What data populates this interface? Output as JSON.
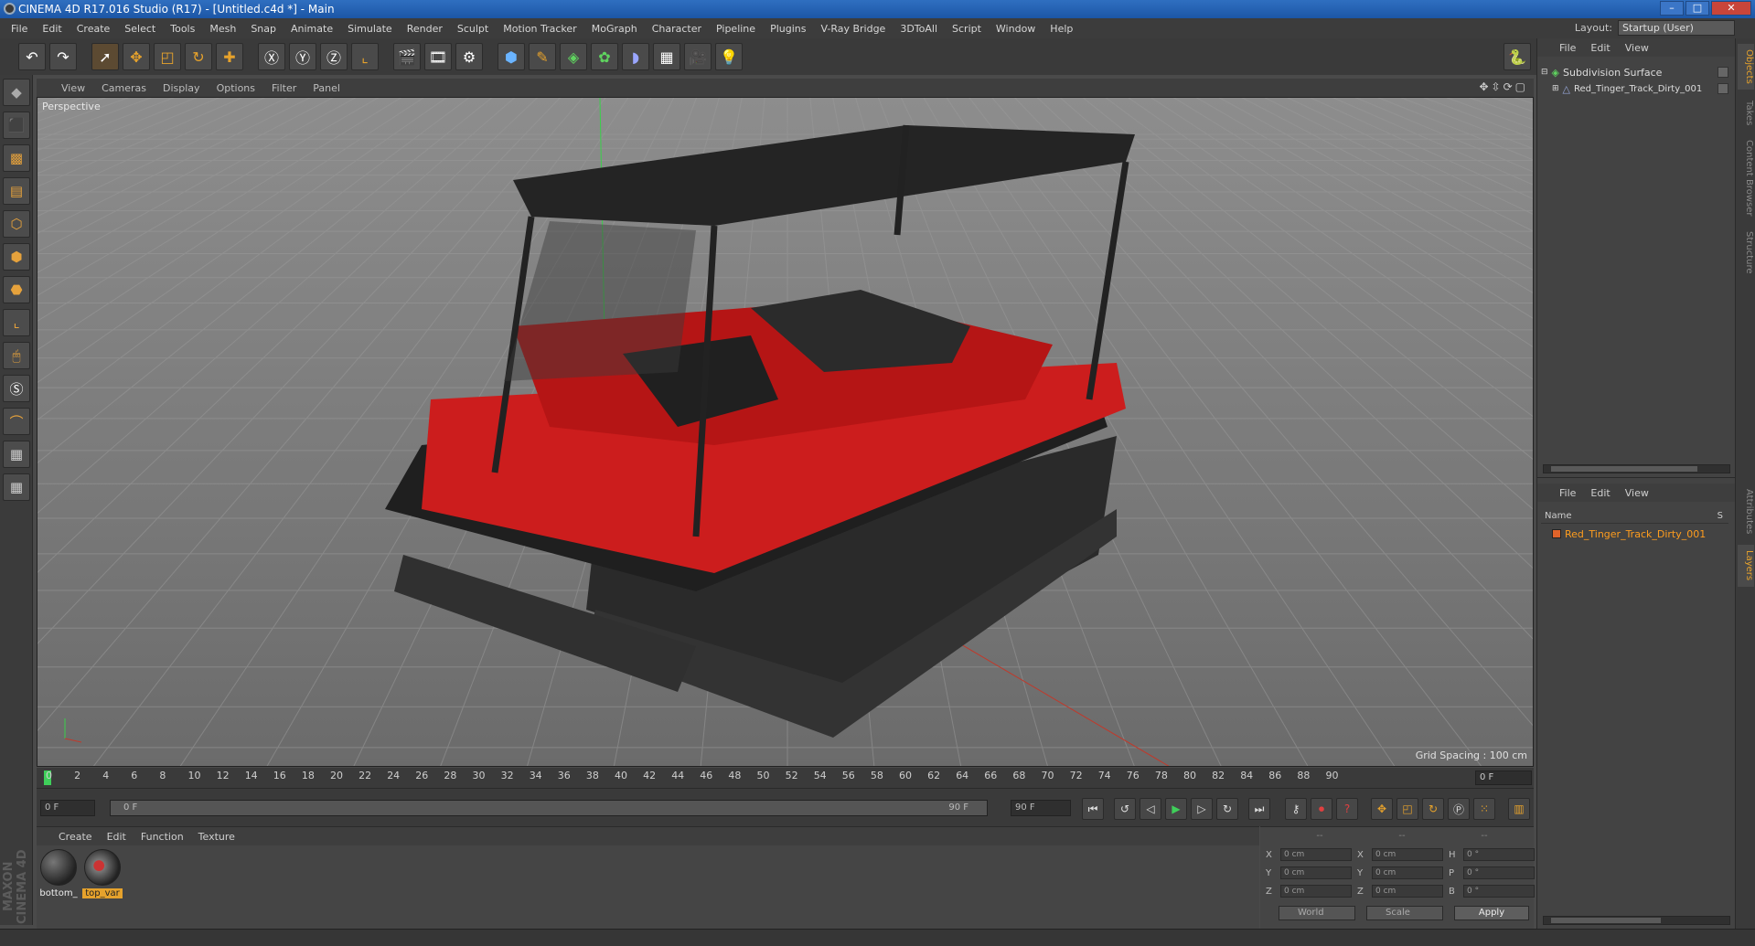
{
  "window": {
    "title": "CINEMA 4D R17.016 Studio (R17) - [Untitled.c4d *] - Main",
    "min": "–",
    "max": "□",
    "close": "✕"
  },
  "menu": [
    "File",
    "Edit",
    "Create",
    "Select",
    "Tools",
    "Mesh",
    "Snap",
    "Animate",
    "Simulate",
    "Render",
    "Sculpt",
    "Motion Tracker",
    "MoGraph",
    "Character",
    "Pipeline",
    "Plugins",
    "V-Ray Bridge",
    "3DToAll",
    "Script",
    "Window",
    "Help"
  ],
  "layout": {
    "label": "Layout:",
    "value": "Startup (User)"
  },
  "toolbar_icons": [
    "undo-icon",
    "redo-icon",
    "select-icon",
    "move-icon",
    "scale-icon",
    "rotate-icon",
    "add-icon",
    "x-axis-icon",
    "y-axis-icon",
    "z-axis-icon",
    "coordinate-system-icon",
    "render-view-icon",
    "render-picture-viewer-icon",
    "render-settings-icon",
    "cube-icon",
    "pen-icon",
    "subdivision-icon",
    "array-icon",
    "deformer-icon",
    "floor-icon",
    "camera-icon",
    "light-icon",
    "python-icon"
  ],
  "viewport": {
    "menu": [
      "View",
      "Cameras",
      "Display",
      "Options",
      "Filter",
      "Panel"
    ],
    "label": "Perspective",
    "grid_spacing": "Grid Spacing : 100 cm"
  },
  "timeline": {
    "ticks": [
      "0",
      "2",
      "4",
      "6",
      "8",
      "10",
      "12",
      "14",
      "16",
      "18",
      "20",
      "22",
      "24",
      "26",
      "28",
      "30",
      "32",
      "34",
      "36",
      "38",
      "40",
      "42",
      "44",
      "46",
      "48",
      "50",
      "52",
      "54",
      "56",
      "58",
      "60",
      "62",
      "64",
      "66",
      "68",
      "70",
      "72",
      "74",
      "76",
      "78",
      "80",
      "82",
      "84",
      "86",
      "88",
      "90"
    ],
    "current": "0 F"
  },
  "transport": {
    "start": "0 F",
    "scrub_start": "0 F",
    "scrub_end": "90 F",
    "end": "90 F"
  },
  "materials": {
    "menu": [
      "Create",
      "Edit",
      "Function",
      "Texture"
    ],
    "items": [
      {
        "label": "bottom_",
        "selected": false
      },
      {
        "label": "top_var",
        "selected": true
      }
    ]
  },
  "coords": {
    "header": [
      "--",
      "--",
      "--"
    ],
    "rows": [
      {
        "a": "X",
        "av": "0 cm",
        "b": "X",
        "bv": "0 cm",
        "c": "H",
        "cv": "0 °"
      },
      {
        "a": "Y",
        "av": "0 cm",
        "b": "Y",
        "bv": "0 cm",
        "c": "P",
        "cv": "0 °"
      },
      {
        "a": "Z",
        "av": "0 cm",
        "b": "Z",
        "bv": "0 cm",
        "c": "B",
        "cv": "0 °"
      }
    ],
    "world": "World",
    "scale": "Scale",
    "apply": "Apply"
  },
  "objects": {
    "menu": [
      "File",
      "Edit",
      "View"
    ],
    "items": [
      {
        "name": "Subdivision Surface"
      },
      {
        "name": "Red_Tinger_Track_Dirty_001"
      }
    ]
  },
  "layers": {
    "menu": [
      "File",
      "Edit",
      "View"
    ],
    "header": "Name",
    "header_s": "S",
    "items": [
      {
        "name": "Red_Tinger_Track_Dirty_001"
      }
    ]
  },
  "right_tabs": [
    "Objects",
    "Takes",
    "Content Browser",
    "Structure",
    "Attributes",
    "Layers"
  ],
  "brand": "MAXON CINEMA 4D",
  "colors": {
    "accent": "#e6a22c",
    "vehicle": "#d01e1e",
    "titlebar": "#1c56a6"
  }
}
